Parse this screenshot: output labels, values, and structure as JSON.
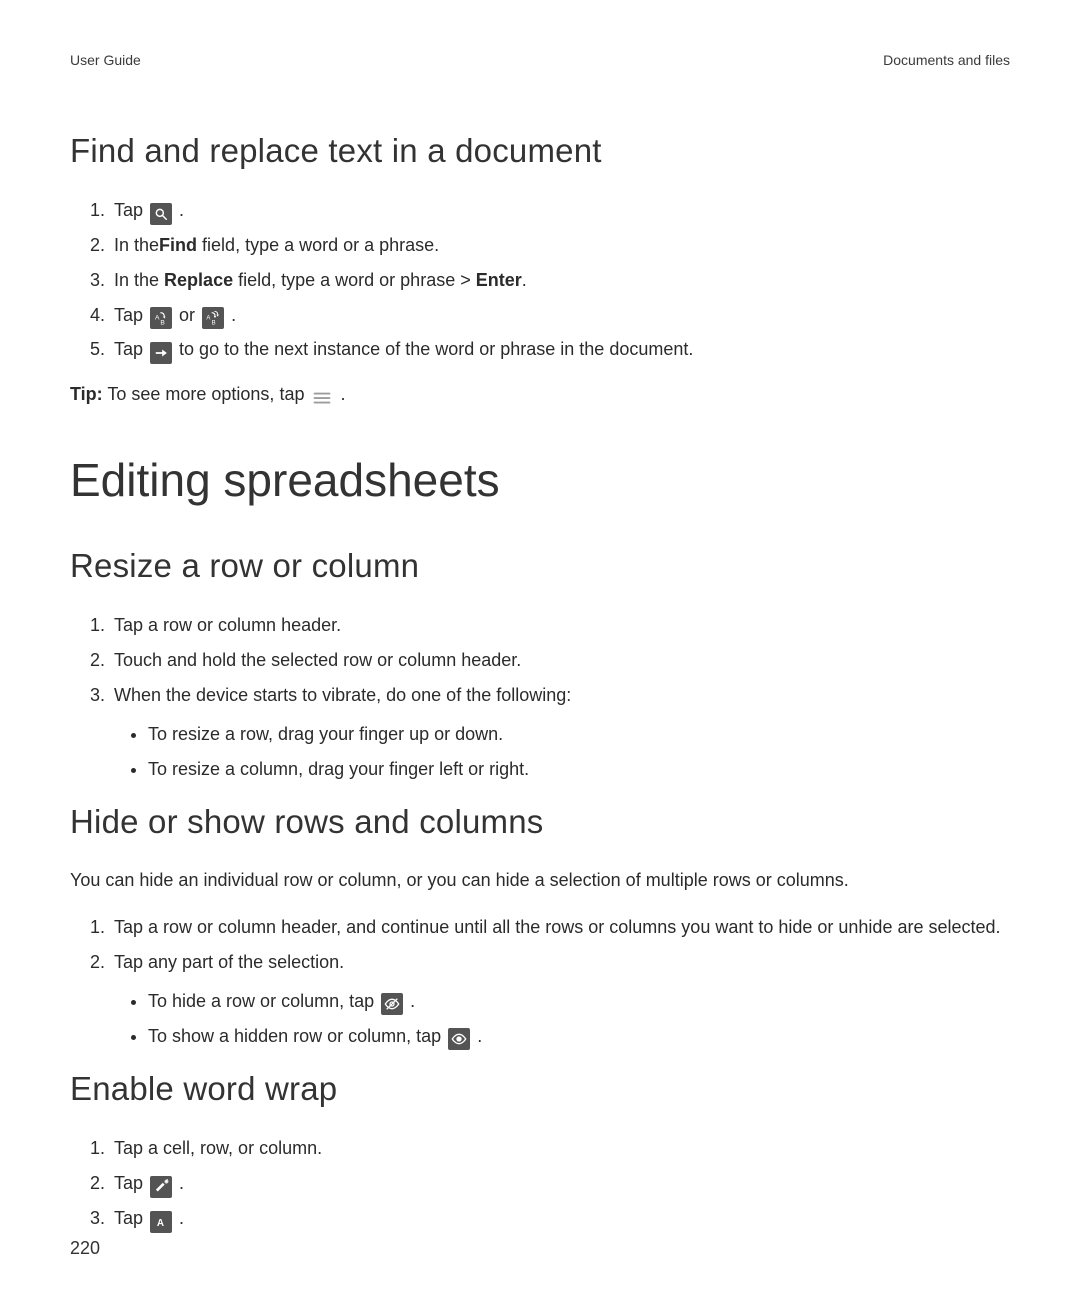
{
  "header": {
    "left": "User Guide",
    "right": "Documents and files"
  },
  "find_replace": {
    "heading": "Find and replace text in a document",
    "step1_before": "Tap ",
    "step1_after": " .",
    "step2_before": "In the",
    "step2_bold": "Find",
    "step2_after": " field, type a word or a phrase.",
    "step3_a": "In the ",
    "step3_b1": "Replace",
    "step3_b": " field, type a word or phrase > ",
    "step3_b2": "Enter",
    "step3_c": ".",
    "step4_before": "Tap ",
    "step4_mid": " or ",
    "step4_after": " .",
    "step5_before": "Tap ",
    "step5_after": " to go to the next instance of the word or phrase in the document.",
    "tip_label": "Tip:",
    "tip_before": " To see more options, tap ",
    "tip_after": " ."
  },
  "section2": {
    "heading": "Editing spreadsheets"
  },
  "resize": {
    "heading": "Resize a row or column",
    "s1": "Tap a row or column header.",
    "s2": "Touch and hold the selected row or column header.",
    "s3": "When the device starts to vibrate, do one of the following:",
    "b1": "To resize a row, drag your finger up or down.",
    "b2": "To resize a column, drag your finger left or right."
  },
  "hide": {
    "heading": "Hide or show rows and columns",
    "intro": "You can hide an individual row or column, or you can hide a selection of multiple rows or columns.",
    "s1": "Tap a row or column header, and continue until all the rows or columns you want to hide or unhide are selected.",
    "s2": "Tap any part of the selection.",
    "b1_before": "To hide a row or column, tap ",
    "b1_after": " .",
    "b2_before": "To show a hidden row or column, tap ",
    "b2_after": " ."
  },
  "wrap": {
    "heading": "Enable word wrap",
    "s1": "Tap a cell, row, or column.",
    "s2_before": "Tap ",
    "s2_after": " .",
    "s3_before": "Tap ",
    "s3_after": " ."
  },
  "page_number": "220"
}
